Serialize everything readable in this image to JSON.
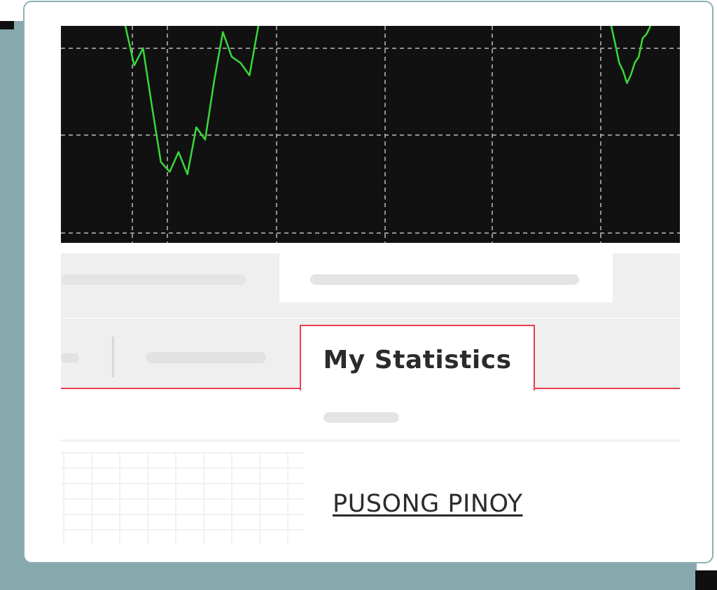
{
  "tabs": {
    "active_label": "My Statistics"
  },
  "footer": {
    "link_text": "PUSONG PINOY"
  },
  "colors": {
    "accent": "#e8404d",
    "chart_line": "#3ad83a",
    "chart_background": "#111111",
    "teal_shadow": "#87a9ad"
  },
  "chart_data": {
    "type": "line",
    "title": "",
    "grid": true,
    "series": [
      {
        "values": [
          [
            0,
            1.0
          ],
          [
            1,
            0.68
          ],
          [
            2,
            0.82
          ],
          [
            3,
            0.35
          ],
          [
            4,
            -0.1
          ],
          [
            5,
            -0.18
          ],
          [
            6,
            -0.02
          ],
          [
            7,
            -0.2
          ],
          [
            8,
            0.18
          ],
          [
            9,
            0.08
          ],
          [
            10,
            0.55
          ],
          [
            11,
            0.95
          ],
          [
            12,
            0.75
          ],
          [
            13,
            0.7
          ],
          [
            14,
            0.6
          ],
          [
            15,
            1.0
          ]
        ]
      },
      {
        "values": [
          [
            0,
            1.0
          ],
          [
            1,
            0.78
          ],
          [
            2,
            0.55
          ],
          [
            3,
            0.45
          ],
          [
            4,
            0.3
          ],
          [
            5,
            0.4
          ],
          [
            6,
            0.55
          ],
          [
            7,
            0.62
          ],
          [
            8,
            0.85
          ],
          [
            9,
            0.9
          ],
          [
            10,
            1.0
          ]
        ]
      }
    ]
  }
}
